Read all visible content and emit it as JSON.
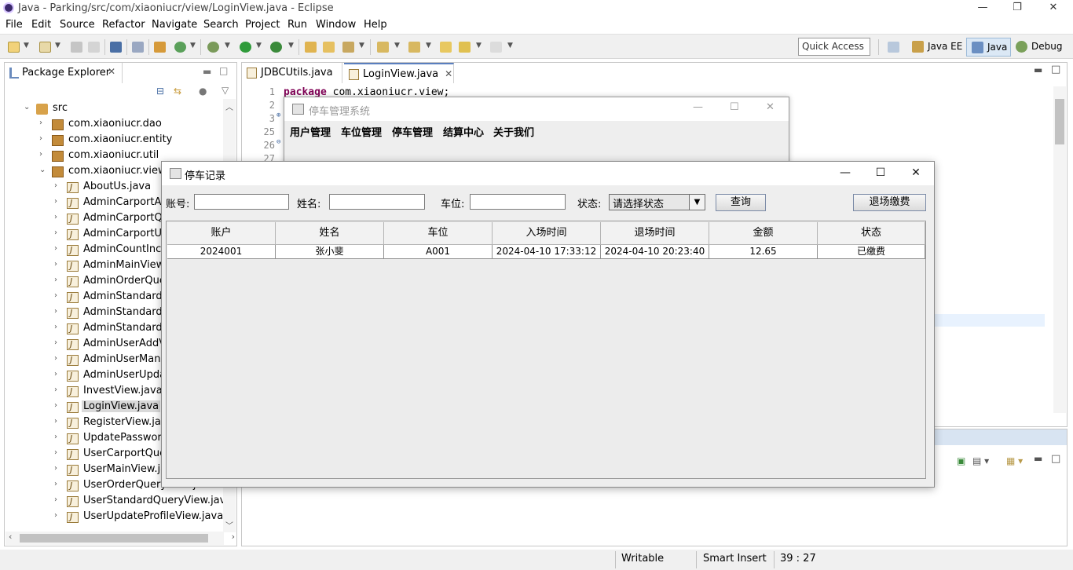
{
  "eclipse": {
    "title": "Java - Parking/src/com/xiaoniucr/view/LoginView.java - Eclipse",
    "menu": [
      "File",
      "Edit",
      "Source",
      "Refactor",
      "Navigate",
      "Search",
      "Project",
      "Run",
      "Window",
      "Help"
    ],
    "quick_access": "Quick Access",
    "perspectives": [
      "Java EE",
      "Java",
      "Debug"
    ]
  },
  "package_explorer": {
    "tab_label": "Package Explorer",
    "tree": [
      {
        "label": "src",
        "type": "src",
        "expanded": true
      },
      {
        "label": "com.xiaoniucr.dao",
        "type": "pkg"
      },
      {
        "label": "com.xiaoniucr.entity",
        "type": "pkg"
      },
      {
        "label": "com.xiaoniucr.util",
        "type": "pkg"
      },
      {
        "label": "com.xiaoniucr.view",
        "type": "pkg",
        "expanded": true
      },
      {
        "label": "AboutUs.java",
        "type": "java"
      },
      {
        "label": "AdminCarportAd",
        "type": "java"
      },
      {
        "label": "AdminCarportQu",
        "type": "java"
      },
      {
        "label": "AdminCarportUp",
        "type": "java"
      },
      {
        "label": "AdminCountIncoi",
        "type": "java"
      },
      {
        "label": "AdminMainView.j",
        "type": "java"
      },
      {
        "label": "AdminOrderQuer",
        "type": "java"
      },
      {
        "label": "AdminStandardA",
        "type": "java"
      },
      {
        "label": "AdminStandardQ",
        "type": "java"
      },
      {
        "label": "AdminStandardU",
        "type": "java"
      },
      {
        "label": "AdminUserAddVi",
        "type": "java"
      },
      {
        "label": "AdminUserManag",
        "type": "java"
      },
      {
        "label": "AdminUserUpdat",
        "type": "java"
      },
      {
        "label": "InvestView.java",
        "type": "java"
      },
      {
        "label": "LoginView.java",
        "type": "java",
        "selected": true
      },
      {
        "label": "RegisterView.java",
        "type": "java"
      },
      {
        "label": "UpdatePassword",
        "type": "java"
      },
      {
        "label": "UserCarportQuer",
        "type": "java"
      },
      {
        "label": "UserMainView.jav",
        "type": "java"
      },
      {
        "label": "UserOrderQueryView.java",
        "type": "java"
      },
      {
        "label": "UserStandardQueryView.java",
        "type": "java"
      },
      {
        "label": "UserUpdateProfileView.java",
        "type": "java"
      }
    ]
  },
  "editor": {
    "tabs": [
      {
        "label": "JDBCUtils.java",
        "active": false
      },
      {
        "label": "LoginView.java",
        "active": true
      }
    ],
    "lines": [
      {
        "num": "1",
        "kw": "package",
        "text": " com.xiaoniucr.view;"
      },
      {
        "num": "2",
        "kw": "",
        "text": ""
      },
      {
        "num": "3",
        "kw": "",
        "text": ""
      },
      {
        "num": "25",
        "kw": "",
        "text": ""
      },
      {
        "num": "26",
        "kw": "",
        "text": ""
      },
      {
        "num": "27",
        "kw": "",
        "text": ""
      }
    ]
  },
  "status": {
    "writable": "Writable",
    "insert_mode": "Smart Insert",
    "position": "39 : 27"
  },
  "parking_main": {
    "title": "停车管理系统",
    "menu": [
      "用户管理",
      "车位管理",
      "停车管理",
      "结算中心",
      "关于我们"
    ]
  },
  "parking_record": {
    "title": "停车记录",
    "filters": {
      "account_label": "账号:",
      "account_value": "",
      "name_label": "姓名:",
      "name_value": "",
      "spot_label": "车位:",
      "spot_value": "",
      "status_label": "状态:",
      "status_selected": "请选择状态"
    },
    "query_button": "查询",
    "checkout_button": "退场缴费",
    "columns": [
      "账户",
      "姓名",
      "车位",
      "入场时间",
      "退场时间",
      "金额",
      "状态"
    ],
    "rows": [
      [
        "2024001",
        "张小斐",
        "A001",
        "2024-04-10 17:33:12",
        "2024-04-10 20:23:40",
        "12.65",
        "已缴费"
      ]
    ]
  }
}
